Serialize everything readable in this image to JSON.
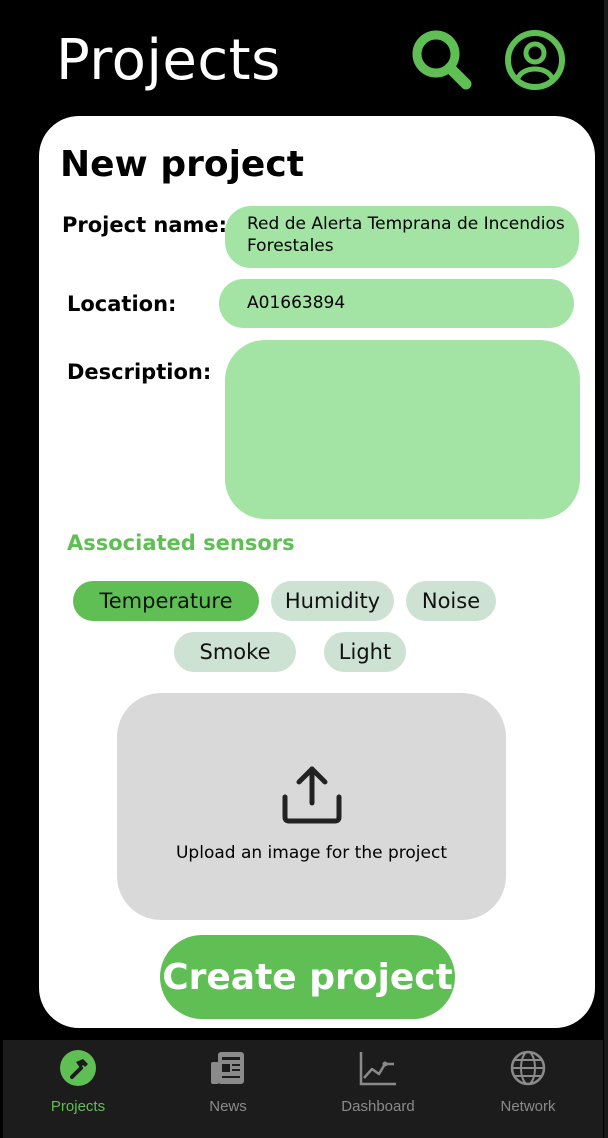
{
  "header": {
    "title": "Projects",
    "search_icon": "search-icon",
    "profile_icon": "user-profile-icon"
  },
  "form": {
    "title": "New project",
    "project_name": {
      "label": "Project name:",
      "value": "Red de Alerta Temprana de Incendios Forestales"
    },
    "location": {
      "label": "Location:",
      "value": "A01663894"
    },
    "description": {
      "label": "Description:",
      "value": ""
    },
    "sensors_label": "Associated sensors",
    "sensors": [
      {
        "label": "Temperature",
        "selected": true
      },
      {
        "label": "Humidity",
        "selected": false
      },
      {
        "label": "Noise",
        "selected": false
      },
      {
        "label": "Smoke",
        "selected": false
      },
      {
        "label": "Light",
        "selected": false
      }
    ],
    "upload": {
      "icon": "upload-icon",
      "text": "Upload an image for the project"
    },
    "submit_label": "Create project"
  },
  "nav": {
    "items": [
      {
        "label": "Projects",
        "icon": "hammer-icon",
        "active": true
      },
      {
        "label": "News",
        "icon": "newspaper-icon",
        "active": false
      },
      {
        "label": "Dashboard",
        "icon": "line-chart-icon",
        "active": false
      },
      {
        "label": "Network",
        "icon": "globe-icon",
        "active": false
      }
    ]
  },
  "colors": {
    "accent": "#5fbf55",
    "input_bg": "#a3e4a4",
    "chip_bg": "#cde2d2",
    "upload_bg": "#d9d9d9",
    "nav_bg": "#1c1c1c"
  }
}
